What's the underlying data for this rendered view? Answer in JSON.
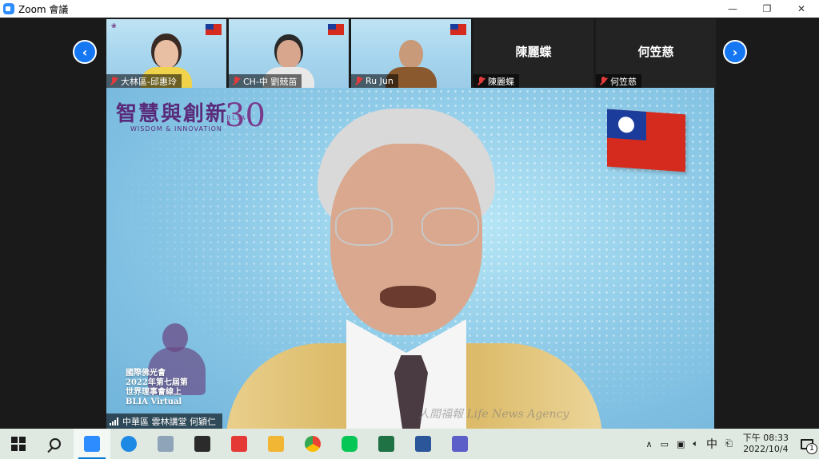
{
  "window": {
    "title": "Zoom 會議",
    "minimize_glyph": "—",
    "restore_glyph": "❐",
    "close_glyph": "✕"
  },
  "gallery": {
    "prev_glyph": "‹",
    "next_glyph": "›",
    "participants": [
      {
        "name": "大林區-邱惠玲",
        "video": true,
        "muted": true
      },
      {
        "name": "CH-中 劉兢苗",
        "video": true,
        "muted": true
      },
      {
        "name": "Ru Jun",
        "video": true,
        "muted": true
      },
      {
        "name": "陳麗蝶",
        "display_name": "陳麗蝶",
        "video": false,
        "muted": true
      },
      {
        "name": "何笠慈",
        "display_name": "何笠慈",
        "video": false,
        "muted": true
      }
    ]
  },
  "main_video": {
    "speaker_name": "中華區 雲林講堂  何穎仁",
    "banner": {
      "brand": "智慧與創新",
      "brand_sub": "WISDOM & INNOVATION",
      "logo_number": "30",
      "logo_text": "BLIA"
    },
    "event_lines": [
      "國際佛光會",
      "2022年第七屆第",
      "世界理事會線上",
      "BLIA Virtual"
    ],
    "watermark": "人間福報 Life News Agency"
  },
  "taskbar": {
    "apps": [
      {
        "name": "zoom",
        "color": "#2d8cff",
        "active": true
      },
      {
        "name": "edge",
        "color": "#1e88e5",
        "active": false
      },
      {
        "name": "files",
        "color": "#8fa4b8",
        "active": false
      },
      {
        "name": "sticky",
        "color": "#2b2b2b",
        "active": false
      },
      {
        "name": "pchome",
        "color": "#e53935",
        "active": false
      },
      {
        "name": "explorer",
        "color": "#f2b635",
        "active": false
      },
      {
        "name": "chrome",
        "color": "#34a853",
        "active": false
      },
      {
        "name": "line",
        "color": "#06c755",
        "active": false
      },
      {
        "name": "excel",
        "color": "#1f7244",
        "active": false
      },
      {
        "name": "word",
        "color": "#2b579a",
        "active": false
      },
      {
        "name": "teams",
        "color": "#5b5fc7",
        "active": false
      }
    ],
    "tray": {
      "chevron": "∧",
      "ime": "中",
      "time": "下午 08:33",
      "date": "2022/10/4",
      "notification_count": "1"
    }
  }
}
